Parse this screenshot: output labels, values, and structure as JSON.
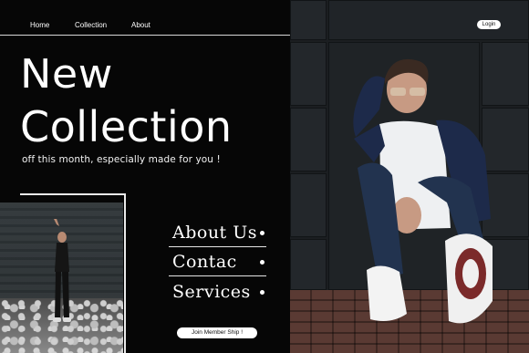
{
  "nav": {
    "items": [
      {
        "label": "Home"
      },
      {
        "label": "Collection"
      },
      {
        "label": "About"
      }
    ],
    "login_label": "Login"
  },
  "hero": {
    "title_line1": "New",
    "title_line2": "Collection",
    "tagline": "off this month, especially made for you !"
  },
  "menu": {
    "items": [
      {
        "label": "About Us"
      },
      {
        "label": "Contac"
      },
      {
        "label": "Services"
      }
    ]
  },
  "cta": {
    "join_label": "Join Member Ship !"
  },
  "colors": {
    "background": "#060606",
    "text": "#ffffff",
    "accent_floor": "#5a3a33"
  }
}
